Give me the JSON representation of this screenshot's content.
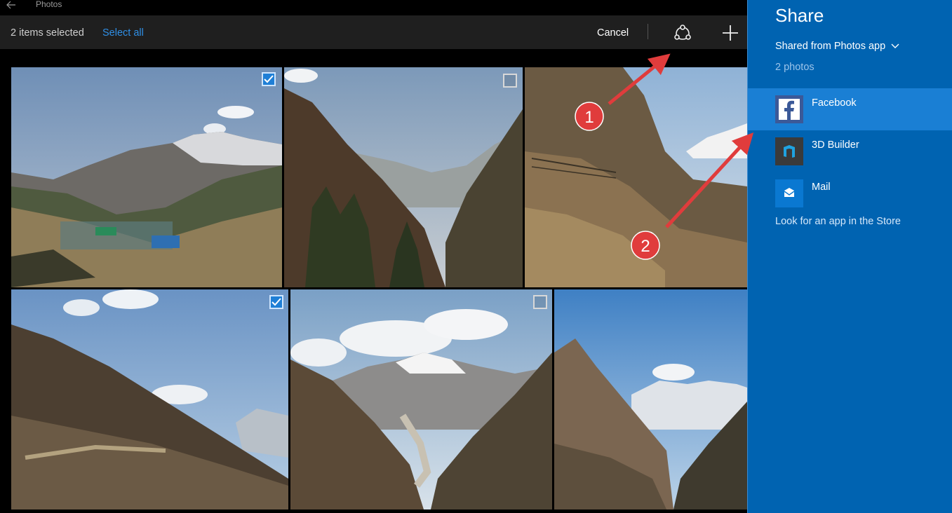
{
  "app": {
    "title": "Photos"
  },
  "toolbar": {
    "selection_text": "2 items selected",
    "select_all_label": "Select all",
    "cancel_label": "Cancel",
    "share_icon": "share-icon",
    "add_icon": "plus-icon"
  },
  "photos": [
    {
      "selected": true
    },
    {
      "selected": false
    },
    {
      "selected": false
    },
    {
      "selected": true
    },
    {
      "selected": false
    },
    {
      "selected": false
    }
  ],
  "annotations": [
    {
      "number": "1"
    },
    {
      "number": "2"
    }
  ],
  "share_pane": {
    "title": "Share",
    "source_label": "Shared from Photos app",
    "count_label": "2 photos",
    "apps": [
      {
        "label": "Facebook",
        "icon": "facebook-icon",
        "active": true
      },
      {
        "label": "3D Builder",
        "icon": "3d-builder-icon",
        "active": false
      },
      {
        "label": "Mail",
        "icon": "mail-icon",
        "active": false
      }
    ],
    "store_link": "Look for an app in the Store"
  },
  "colors": {
    "accent": "#0078d7",
    "pane_bg": "#0063b1",
    "pane_active": "#1a7fd4",
    "link_blue": "#2f8fe6",
    "annotation_red": "#e03c3c"
  }
}
